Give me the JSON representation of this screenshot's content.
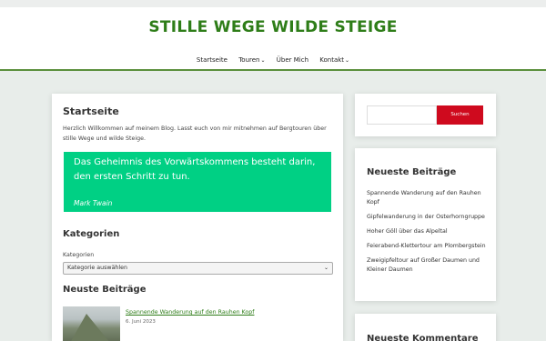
{
  "site": {
    "title": "STILLE WEGE WILDE STEIGE"
  },
  "nav": {
    "items": [
      {
        "label": "Startseite"
      },
      {
        "label": "Touren"
      },
      {
        "label": "Über Mich"
      },
      {
        "label": "Kontakt"
      }
    ]
  },
  "main": {
    "title": "Startseite",
    "intro": "Herzlich Willkommen auf meinem Blog. Lasst euch von mir mitnehmen auf Bergtouren über stille Wege und wilde Steige.",
    "quote": {
      "text": "Das Geheimnis des Vorwärtskommens besteht darin, den ersten Schritt zu tun.",
      "cite": "Mark Twain"
    },
    "categories": {
      "title": "Kategorien",
      "label": "Kategorien",
      "select_value": "Kategorie auswählen"
    },
    "posts": {
      "title": "Neuste Beiträge",
      "items": [
        {
          "title": "Spannende Wanderung auf den Rauhen Kopf",
          "date": "6. Juni 2023"
        }
      ]
    }
  },
  "sidebar": {
    "search": {
      "button_label": "Suchen",
      "placeholder": ""
    },
    "recent": {
      "title": "Neueste Beiträge",
      "items": [
        "Spannende Wanderung auf den Rauhen Kopf",
        "Gipfelwanderung in der Osterhorngruppe",
        "Hoher Göll über das Alpeltal",
        "Feierabend-Klettertour am Plombergstein",
        "Zweigipfeltour auf Großer Daumen und Kleiner Daumen"
      ]
    },
    "comments": {
      "title": "Neueste Kommentare"
    }
  },
  "colors": {
    "brand_green": "#2e7d18",
    "quote_bg": "#00d084",
    "search_button": "#cf0a1e",
    "page_bg": "#e8edea"
  },
  "icons": {
    "dropdown": "chevron-down-icon"
  }
}
